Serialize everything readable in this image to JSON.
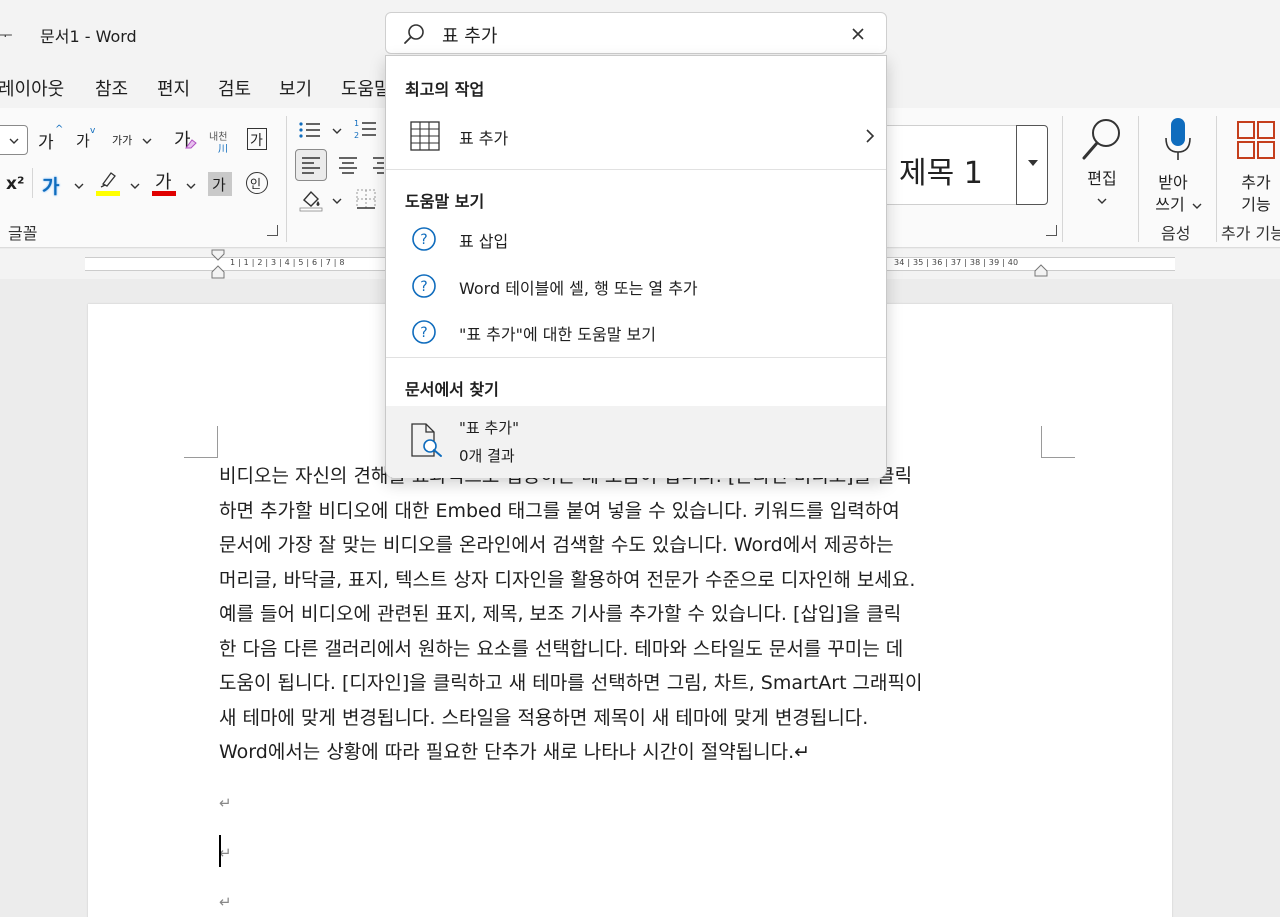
{
  "window": {
    "title_fragment": "ᅮ",
    "doc_title": "문서1  -  Word"
  },
  "menu": {
    "tabs": [
      "레이아웃",
      "참조",
      "편지",
      "검토",
      "보기",
      "도움말"
    ]
  },
  "ribbon": {
    "font_group_label": "글꼴",
    "grow_font": "가",
    "shrink_font": "가",
    "change_case": "가가",
    "clear_format": "가",
    "phonetic": "내천",
    "phonetic_sub": "川",
    "enclose_char": "가",
    "superscript": "x²",
    "text_effect": "가",
    "highlight_char": "가",
    "font_color_char": "가",
    "shading_char": "가",
    "enclose_circle": "인",
    "style_name": "제목 1",
    "edit_label": "편집",
    "dictate_label_1": "받아",
    "dictate_label_2": "쓰기",
    "voice_group_label": "음성",
    "addins_label_1": "추가",
    "addins_label_2": "기능",
    "addins_group_label": "추가 기능"
  },
  "ruler": {
    "left_nums": "1 | 1 | 2 | 3 | 4 | 5 | 6 | 7 | 8",
    "right_nums": "34 | 35 | 36 | 37 | 38 | 39 | 40"
  },
  "search": {
    "query": "표 추가"
  },
  "dropdown": {
    "top_actions_title": "최고의 작업",
    "top_action": "표 추가",
    "help_title": "도움말 보기",
    "help_items": [
      "표 삽입",
      "Word 테이블에 셀, 행 또는 열 추가",
      "\"표 추가\"에 대한 도움말 보기"
    ],
    "find_title": "문서에서 찾기",
    "find_query": "\"표 추가\"",
    "find_result": "0개 결과"
  },
  "document": {
    "lines": [
      "비디오는 자신의 견해를 효과적으로 입증하는 데 도움이 됩니다. [온라인 비디오]를 클릭",
      "하면 추가할 비디오에 대한 Embed 태그를 붙여 넣을 수 있습니다. 키워드를 입력하여",
      "문서에 가장 잘 맞는 비디오를 온라인에서 검색할 수도 있습니다. Word에서 제공하는",
      "머리글, 바닥글, 표지, 텍스트 상자 디자인을 활용하여 전문가 수준으로 디자인해 보세요.",
      "예를 들어 비디오에 관련된 표지, 제목, 보조 기사를 추가할 수 있습니다. [삽입]을 클릭",
      "한 다음 다른 갤러리에서 원하는 요소를 선택합니다. 테마와 스타일도 문서를 꾸미는 데",
      "도움이 됩니다. [디자인]을 클릭하고 새 테마를 선택하면 그림, 차트, SmartArt 그래픽이",
      "새 테마에 맞게 변경됩니다. 스타일을 적용하면 제목이 새 테마에 맞게 변경됩니다.",
      "Word에서는 상황에 따라 필요한 단추가 새로 나타나 시간이 절약됩니다.↵"
    ],
    "para_mark": "↵"
  },
  "colors": {
    "accent_blue": "#0f6cbd",
    "highlight_yellow": "#ffff00",
    "font_red": "#e00000",
    "addins_red": "#c43e1c"
  }
}
